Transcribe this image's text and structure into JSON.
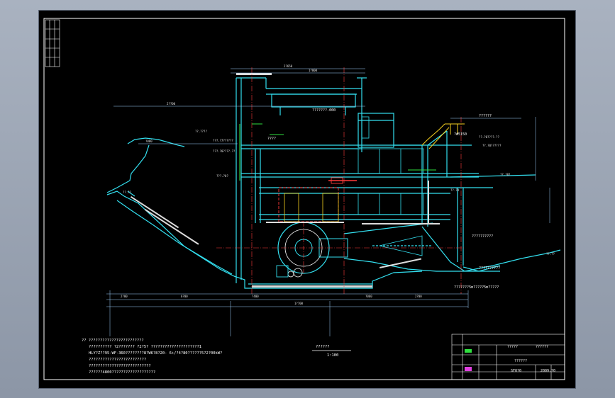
{
  "drawing": {
    "title": "??????",
    "scale": "1:100",
    "notes": [
      "??  ????????????????????????",
      "??????????  ?2???????    ?2?5?  ?????????????????????1",
      "HLY?Z??95-WF-360????????8?W6?8?20-  6+/?4?80??????5?2?00kW?",
      "?????????????????????????",
      "???????????????????????????",
      "??????4800???????????????????"
    ]
  },
  "title_block": {
    "project_title": "??????",
    "drawing_name": "??????",
    "code": "SF0?0",
    "date": "2009.?0",
    "sig_mark": "?????"
  },
  "labels": {
    "machine_hall": "????",
    "generator_floor": "???????.000",
    "right_annotation": "??????",
    "elevation_right": "?#5150",
    "gate_note": "???????5m?????5m?????",
    "upstream_water_level": "??????????",
    "downstream_water_level": "??????????"
  },
  "colors": {
    "structure": "#33e0f0",
    "axis": "#ff3b3b",
    "dimension": "#9fd3ff",
    "text": "#ffffff",
    "hatch": "#dcdcdc",
    "yellow": "#f5d020",
    "green": "#30e040",
    "magenta": "#e040e0"
  }
}
